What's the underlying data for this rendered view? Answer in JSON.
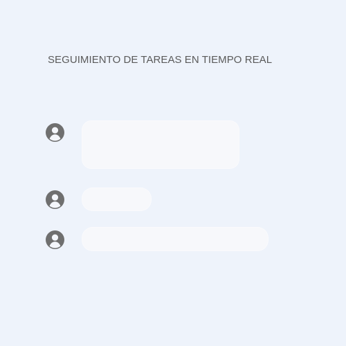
{
  "header": {
    "title": "SEGUIMIENTO DE TAREAS EN TIEMPO REAL"
  },
  "feed": {
    "items": [
      {
        "icon": "user-avatar-icon",
        "text": ""
      },
      {
        "icon": "user-avatar-icon",
        "text": ""
      },
      {
        "icon": "user-avatar-icon",
        "text": ""
      }
    ]
  },
  "colors": {
    "background": "#eef3fb",
    "title_text": "#5a5a5a",
    "avatar": "#6f6f6f",
    "bubble": "#f7f8fb"
  }
}
